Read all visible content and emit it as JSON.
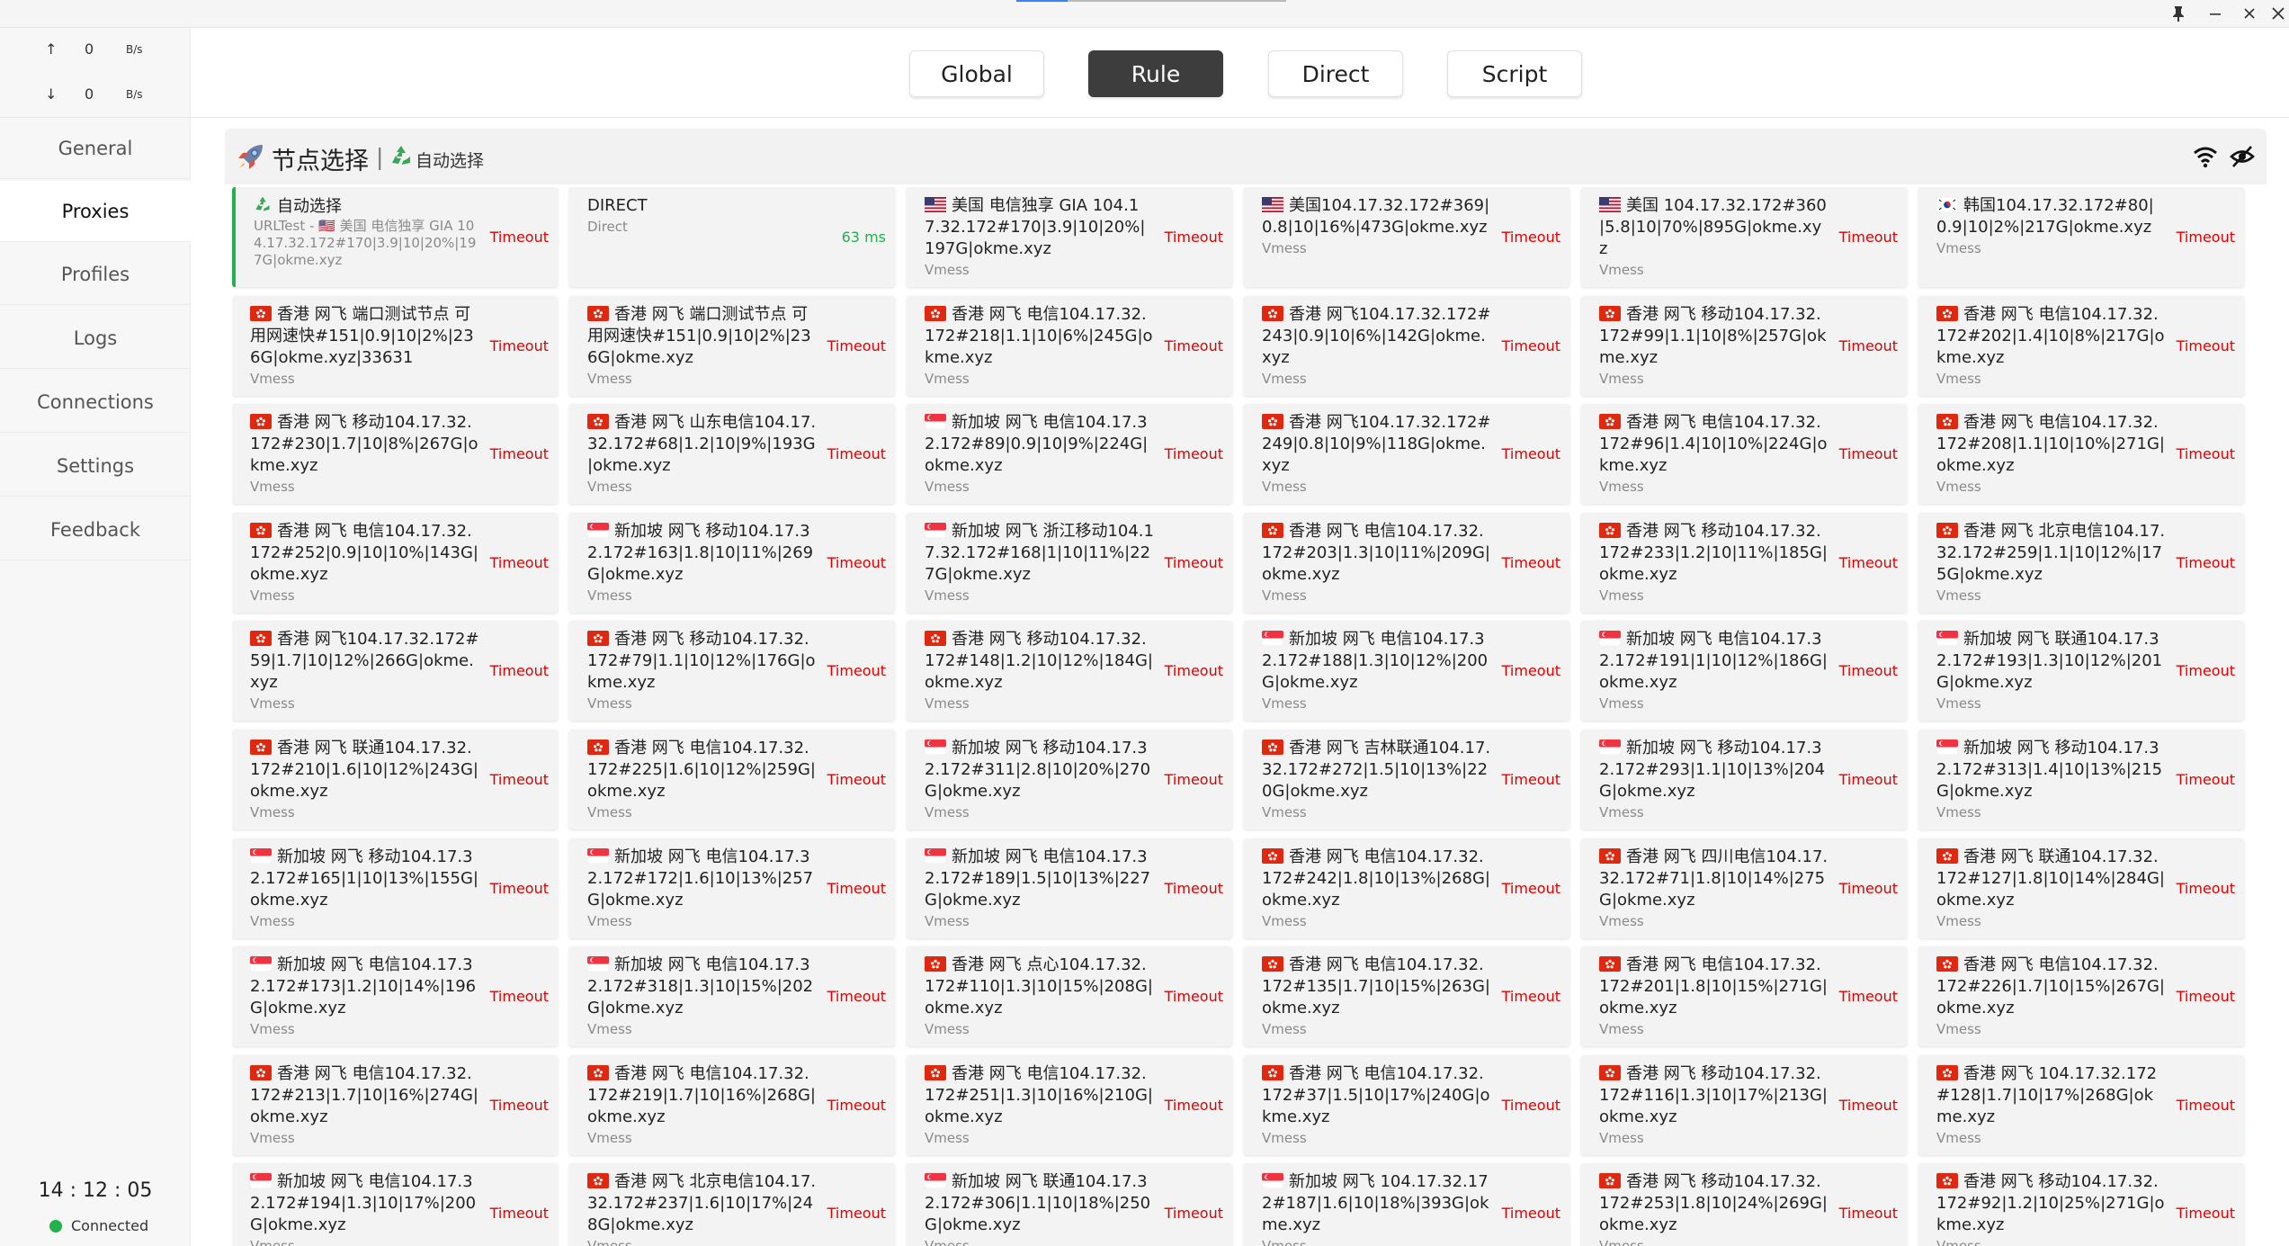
{
  "window": {
    "pin": "📌",
    "minimize": "—",
    "maximize": "✕",
    "close": "✕"
  },
  "sidebar": {
    "upload": {
      "arrow": "↑",
      "value": "0",
      "unit": "B/s"
    },
    "download": {
      "arrow": "↓",
      "value": "0",
      "unit": "B/s"
    },
    "nav": [
      "General",
      "Proxies",
      "Profiles",
      "Logs",
      "Connections",
      "Settings",
      "Feedback"
    ],
    "active_nav": "Proxies",
    "clock": "14 : 12 : 05",
    "status": "Connected"
  },
  "modes": [
    "Global",
    "Rule",
    "Direct",
    "Script"
  ],
  "active_mode": "Rule",
  "group": {
    "title": "节点选择",
    "separator": "|",
    "selected": "自动选择",
    "icons": [
      "rocket-icon",
      "recycle-icon",
      "wifi-icon",
      "eye-off-icon"
    ]
  },
  "colors": {
    "timeout": "#e00000",
    "ok": "#22b14c",
    "active_mode_bg": "#3d3d3d",
    "selected_bar": "#22b14c"
  },
  "cards": [
    {
      "flag": "recycle",
      "name": "自动选择",
      "sub": "URLTest - 🇺🇸 美国 电信独享 GIA 104.17.32.172#170|3.9|10|20%|197G|okme.xyz",
      "type": "",
      "delay": "Timeout",
      "selected": true
    },
    {
      "flag": "",
      "name": "DIRECT",
      "type": "Direct",
      "delay": "63 ms"
    },
    {
      "flag": "us",
      "name": "美国 电信独享 GIA 104.17.32.172#170|3.9|10|20%|197G|okme.xyz",
      "type": "Vmess",
      "delay": "Timeout"
    },
    {
      "flag": "us",
      "name": "美国104.17.32.172#369|0.8|10|16%|473G|okme.xyz",
      "type": "Vmess",
      "delay": "Timeout"
    },
    {
      "flag": "us",
      "name": "美国 104.17.32.172#360|5.8|10|70%|895G|okme.xyz",
      "type": "Vmess",
      "delay": "Timeout"
    },
    {
      "flag": "kr",
      "name": "韩国104.17.32.172#80|0.9|10|2%|217G|okme.xyz",
      "type": "Vmess",
      "delay": "Timeout"
    },
    {
      "flag": "hk",
      "name": "香港 网飞 端口测试节点 可用网速快#151|0.9|10|2%|236G|okme.xyz|33631",
      "type": "Vmess",
      "delay": "Timeout"
    },
    {
      "flag": "hk",
      "name": "香港 网飞 端口测试节点 可用网速快#151|0.9|10|2%|236G|okme.xyz",
      "type": "Vmess",
      "delay": "Timeout"
    },
    {
      "flag": "hk",
      "name": "香港 网飞 电信104.17.32.172#218|1.1|10|6%|245G|okme.xyz",
      "type": "Vmess",
      "delay": "Timeout"
    },
    {
      "flag": "hk",
      "name": "香港 网飞104.17.32.172#243|0.9|10|6%|142G|okme.xyz",
      "type": "Vmess",
      "delay": "Timeout"
    },
    {
      "flag": "hk",
      "name": "香港 网飞 移动104.17.32.172#99|1.1|10|8%|257G|okme.xyz",
      "type": "Vmess",
      "delay": "Timeout"
    },
    {
      "flag": "hk",
      "name": "香港 网飞 电信104.17.32.172#202|1.4|10|8%|217G|okme.xyz",
      "type": "Vmess",
      "delay": "Timeout"
    },
    {
      "flag": "hk",
      "name": "香港 网飞 移动104.17.32.172#230|1.7|10|8%|267G|okme.xyz",
      "type": "Vmess",
      "delay": "Timeout"
    },
    {
      "flag": "hk",
      "name": "香港 网飞 山东电信104.17.32.172#68|1.2|10|9%|193G|okme.xyz",
      "type": "Vmess",
      "delay": "Timeout"
    },
    {
      "flag": "sg",
      "name": "新加坡 网飞 电信104.17.32.172#89|0.9|10|9%|224G|okme.xyz",
      "type": "Vmess",
      "delay": "Timeout"
    },
    {
      "flag": "hk",
      "name": "香港 网飞104.17.32.172#249|0.8|10|9%|118G|okme.xyz",
      "type": "Vmess",
      "delay": "Timeout"
    },
    {
      "flag": "hk",
      "name": "香港 网飞 电信104.17.32.172#96|1.4|10|10%|224G|okme.xyz",
      "type": "Vmess",
      "delay": "Timeout"
    },
    {
      "flag": "hk",
      "name": "香港 网飞 电信104.17.32.172#208|1.1|10|10%|271G|okme.xyz",
      "type": "Vmess",
      "delay": "Timeout"
    },
    {
      "flag": "hk",
      "name": "香港 网飞 电信104.17.32.172#252|0.9|10|10%|143G|okme.xyz",
      "type": "Vmess",
      "delay": "Timeout"
    },
    {
      "flag": "sg",
      "name": "新加坡 网飞 移动104.17.32.172#163|1.8|10|11%|269G|okme.xyz",
      "type": "Vmess",
      "delay": "Timeout"
    },
    {
      "flag": "sg",
      "name": "新加坡 网飞 浙江移动104.17.32.172#168|1|10|11%|227G|okme.xyz",
      "type": "Vmess",
      "delay": "Timeout"
    },
    {
      "flag": "hk",
      "name": "香港 网飞 电信104.17.32.172#203|1.3|10|11%|209G|okme.xyz",
      "type": "Vmess",
      "delay": "Timeout"
    },
    {
      "flag": "hk",
      "name": "香港 网飞 移动104.17.32.172#233|1.2|10|11%|185G|okme.xyz",
      "type": "Vmess",
      "delay": "Timeout"
    },
    {
      "flag": "hk",
      "name": "香港 网飞 北京电信104.17.32.172#259|1.1|10|12%|175G|okme.xyz",
      "type": "Vmess",
      "delay": "Timeout"
    },
    {
      "flag": "hk",
      "name": "香港 网飞104.17.32.172#59|1.7|10|12%|266G|okme.xyz",
      "type": "Vmess",
      "delay": "Timeout"
    },
    {
      "flag": "hk",
      "name": "香港 网飞 移动104.17.32.172#79|1.1|10|12%|176G|okme.xyz",
      "type": "Vmess",
      "delay": "Timeout"
    },
    {
      "flag": "hk",
      "name": "香港 网飞 移动104.17.32.172#148|1.2|10|12%|184G|okme.xyz",
      "type": "Vmess",
      "delay": "Timeout"
    },
    {
      "flag": "sg",
      "name": "新加坡 网飞 电信104.17.32.172#188|1.3|10|12%|200G|okme.xyz",
      "type": "Vmess",
      "delay": "Timeout"
    },
    {
      "flag": "sg",
      "name": "新加坡 网飞 电信104.17.32.172#191|1|10|12%|186G|okme.xyz",
      "type": "Vmess",
      "delay": "Timeout"
    },
    {
      "flag": "sg",
      "name": "新加坡 网飞 联通104.17.32.172#193|1.3|10|12%|201G|okme.xyz",
      "type": "Vmess",
      "delay": "Timeout"
    },
    {
      "flag": "hk",
      "name": "香港 网飞 联通104.17.32.172#210|1.6|10|12%|243G|okme.xyz",
      "type": "Vmess",
      "delay": "Timeout"
    },
    {
      "flag": "hk",
      "name": "香港 网飞 电信104.17.32.172#225|1.6|10|12%|259G|okme.xyz",
      "type": "Vmess",
      "delay": "Timeout"
    },
    {
      "flag": "sg",
      "name": "新加坡 网飞 移动104.17.32.172#311|2.8|10|20%|270G|okme.xyz",
      "type": "Vmess",
      "delay": "Timeout"
    },
    {
      "flag": "hk",
      "name": "香港 网飞 吉林联通104.17.32.172#272|1.5|10|13%|220G|okme.xyz",
      "type": "Vmess",
      "delay": "Timeout"
    },
    {
      "flag": "sg",
      "name": "新加坡 网飞 移动104.17.32.172#293|1.1|10|13%|204G|okme.xyz",
      "type": "Vmess",
      "delay": "Timeout"
    },
    {
      "flag": "sg",
      "name": "新加坡 网飞 移动104.17.32.172#313|1.4|10|13%|215G|okme.xyz",
      "type": "Vmess",
      "delay": "Timeout"
    },
    {
      "flag": "sg",
      "name": "新加坡 网飞 移动104.17.32.172#165|1|10|13%|155G|okme.xyz",
      "type": "Vmess",
      "delay": "Timeout"
    },
    {
      "flag": "sg",
      "name": "新加坡 网飞 电信104.17.32.172#172|1.6|10|13%|257G|okme.xyz",
      "type": "Vmess",
      "delay": "Timeout"
    },
    {
      "flag": "sg",
      "name": "新加坡 网飞 电信104.17.32.172#189|1.5|10|13%|227G|okme.xyz",
      "type": "Vmess",
      "delay": "Timeout"
    },
    {
      "flag": "hk",
      "name": "香港 网飞 电信104.17.32.172#242|1.8|10|13%|268G|okme.xyz",
      "type": "Vmess",
      "delay": "Timeout"
    },
    {
      "flag": "hk",
      "name": "香港 网飞 四川电信104.17.32.172#71|1.8|10|14%|275G|okme.xyz",
      "type": "Vmess",
      "delay": "Timeout"
    },
    {
      "flag": "hk",
      "name": "香港 网飞 联通104.17.32.172#127|1.8|10|14%|284G|okme.xyz",
      "type": "Vmess",
      "delay": "Timeout"
    },
    {
      "flag": "sg",
      "name": "新加坡 网飞 电信104.17.32.172#173|1.2|10|14%|196G|okme.xyz",
      "type": "Vmess",
      "delay": "Timeout"
    },
    {
      "flag": "sg",
      "name": "新加坡 网飞 电信104.17.32.172#318|1.3|10|15%|202G|okme.xyz",
      "type": "Vmess",
      "delay": "Timeout"
    },
    {
      "flag": "hk",
      "name": "香港 网飞 点心104.17.32.172#110|1.3|10|15%|208G|okme.xyz",
      "type": "Vmess",
      "delay": "Timeout"
    },
    {
      "flag": "hk",
      "name": "香港 网飞 电信104.17.32.172#135|1.7|10|15%|263G|okme.xyz",
      "type": "Vmess",
      "delay": "Timeout"
    },
    {
      "flag": "hk",
      "name": "香港 网飞 电信104.17.32.172#201|1.8|10|15%|271G|okme.xyz",
      "type": "Vmess",
      "delay": "Timeout"
    },
    {
      "flag": "hk",
      "name": "香港 网飞 电信104.17.32.172#226|1.7|10|15%|267G|okme.xyz",
      "type": "Vmess",
      "delay": "Timeout"
    },
    {
      "flag": "hk",
      "name": "香港 网飞 电信104.17.32.172#213|1.7|10|16%|274G|okme.xyz",
      "type": "Vmess",
      "delay": "Timeout"
    },
    {
      "flag": "hk",
      "name": "香港 网飞 电信104.17.32.172#219|1.7|10|16%|268G|okme.xyz",
      "type": "Vmess",
      "delay": "Timeout"
    },
    {
      "flag": "hk",
      "name": "香港 网飞 电信104.17.32.172#251|1.3|10|16%|210G|okme.xyz",
      "type": "Vmess",
      "delay": "Timeout"
    },
    {
      "flag": "hk",
      "name": "香港 网飞 电信104.17.32.172#37|1.5|10|17%|240G|okme.xyz",
      "type": "Vmess",
      "delay": "Timeout"
    },
    {
      "flag": "hk",
      "name": "香港 网飞 移动104.17.32.172#116|1.3|10|17%|213G|okme.xyz",
      "type": "Vmess",
      "delay": "Timeout"
    },
    {
      "flag": "hk",
      "name": "香港 网飞 104.17.32.172#128|1.7|10|17%|268G|okme.xyz",
      "type": "Vmess",
      "delay": "Timeout"
    },
    {
      "flag": "sg",
      "name": "新加坡 网飞 电信104.17.32.172#194|1.3|10|17%|200G|okme.xyz",
      "type": "Vmess",
      "delay": "Timeout"
    },
    {
      "flag": "hk",
      "name": "香港 网飞 北京电信104.17.32.172#237|1.6|10|17%|248G|okme.xyz",
      "type": "Vmess",
      "delay": "Timeout"
    },
    {
      "flag": "sg",
      "name": "新加坡 网飞 联通104.17.32.172#306|1.1|10|18%|250G|okme.xyz",
      "type": "Vmess",
      "delay": "Timeout"
    },
    {
      "flag": "sg",
      "name": "新加坡 网飞 104.17.32.172#187|1.6|10|18%|393G|okme.xyz",
      "type": "Vmess",
      "delay": "Timeout"
    },
    {
      "flag": "hk",
      "name": "香港 网飞 移动104.17.32.172#253|1.8|10|24%|269G|okme.xyz",
      "type": "Vmess",
      "delay": "Timeout"
    },
    {
      "flag": "hk",
      "name": "香港 网飞 移动104.17.32.172#92|1.2|10|25%|271G|okme.xyz",
      "type": "Vmess",
      "delay": "Timeout"
    }
  ]
}
